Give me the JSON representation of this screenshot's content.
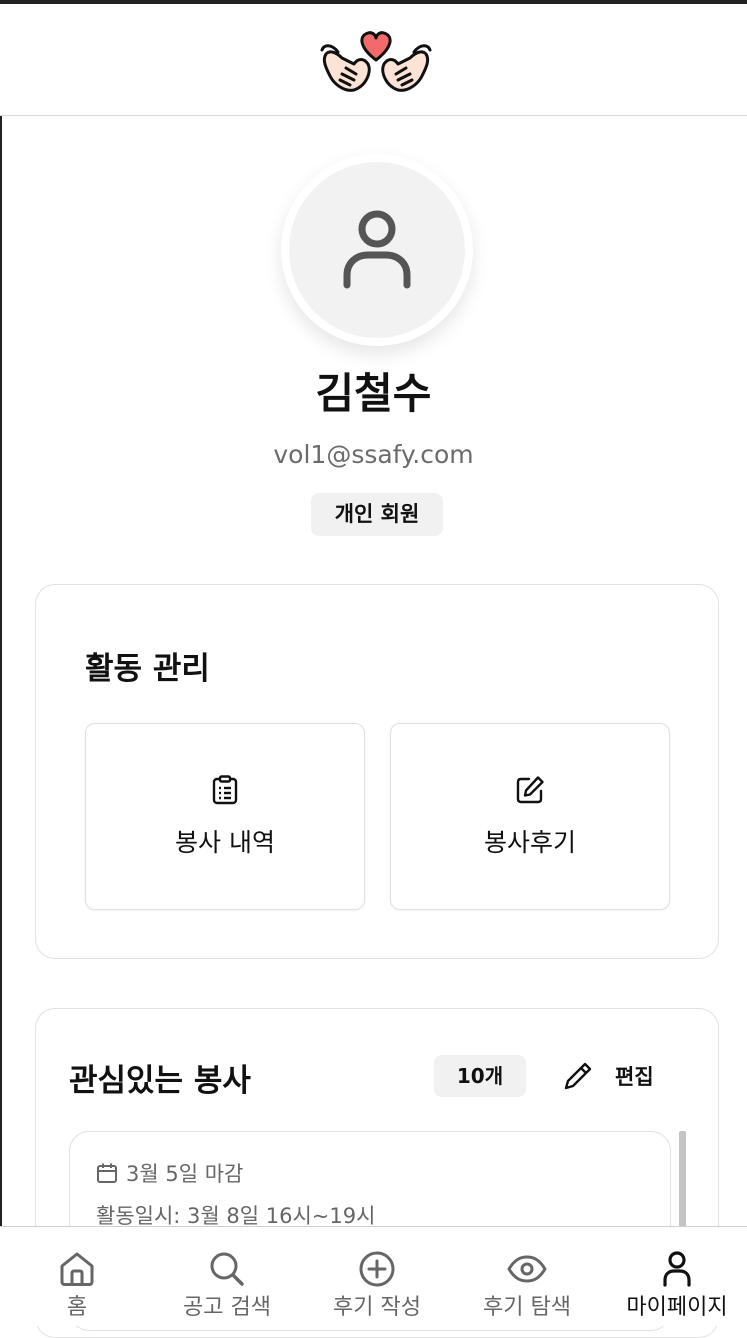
{
  "profile": {
    "name": "김철수",
    "email": "vol1@ssafy.com",
    "member_type": "개인 회원"
  },
  "activity": {
    "title": "활동 관리",
    "tiles": [
      {
        "label": "봉사 내역",
        "icon": "clipboard-icon"
      },
      {
        "label": "봉사후기",
        "icon": "edit-square-icon"
      }
    ]
  },
  "interests": {
    "title": "관심있는 봉사",
    "count": "10개",
    "edit_label": "편집",
    "items": [
      {
        "deadline": "3월 5일 마감",
        "period": "활동일시: 3월 8일 16시~19시"
      }
    ]
  },
  "nav": {
    "items": [
      {
        "label": "홈",
        "icon": "home-icon"
      },
      {
        "label": "공고 검색",
        "icon": "search-icon"
      },
      {
        "label": "후기 작성",
        "icon": "plus-circle-icon"
      },
      {
        "label": "후기 탐색",
        "icon": "eye-icon"
      },
      {
        "label": "마이페이지",
        "icon": "user-icon",
        "active": true
      }
    ]
  },
  "colors": {
    "heart": "#f26b6b",
    "text_muted": "#6b6b6b",
    "badge_bg": "#f1f1f1",
    "avatar_bg": "#f2f2f2"
  }
}
